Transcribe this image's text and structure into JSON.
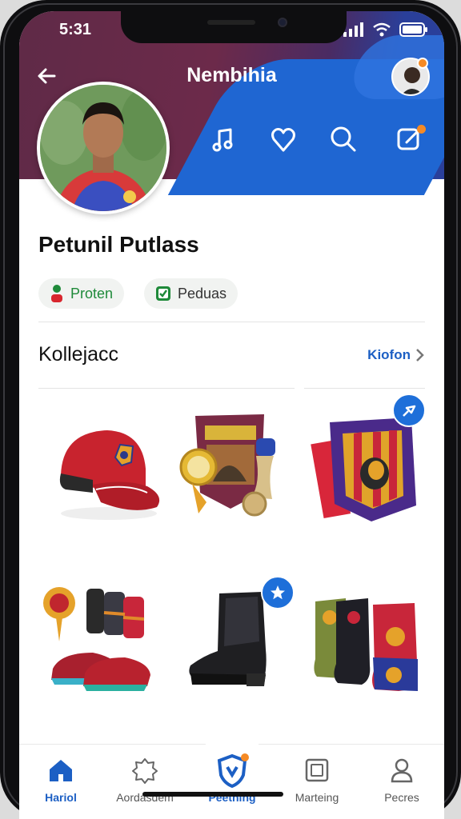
{
  "status": {
    "time": "5:31"
  },
  "header": {
    "title": "Nembihia"
  },
  "profile": {
    "name": "Petunil Putlass"
  },
  "chips": [
    {
      "label": "Proten"
    },
    {
      "label": "Peduas"
    }
  ],
  "collection": {
    "title": "Kollejacc",
    "more_label": "Kiofon"
  },
  "items": [
    {
      "name": "red-cap"
    },
    {
      "name": "medal-set"
    },
    {
      "name": "club-pennant"
    },
    {
      "name": "red-sneakers"
    },
    {
      "name": "black-boot"
    },
    {
      "name": "colored-boots"
    }
  ],
  "nav": [
    {
      "label": "Hariol"
    },
    {
      "label": "Aordasdem"
    },
    {
      "label": "Peething"
    },
    {
      "label": "Marteing"
    },
    {
      "label": "Pecres"
    }
  ],
  "colors": {
    "accent": "#1e6fd9",
    "brand": "#6c2a4a",
    "notify": "#f58a25"
  }
}
